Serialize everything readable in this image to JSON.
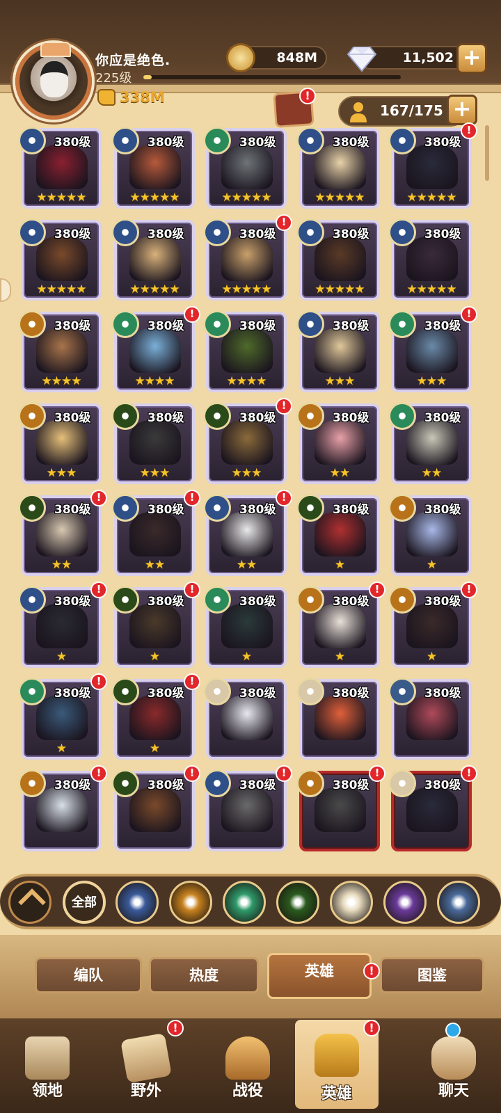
{
  "player": {
    "name": "你应是绝色.",
    "level": "225级",
    "power": "338M"
  },
  "resources": {
    "gold": "848M",
    "diamonds": "11,502"
  },
  "hero_count": "167/175",
  "heroes": [
    {
      "level": "380级",
      "stars": "★★★★★",
      "faction": "lightbearer",
      "notif": false,
      "frame": "purple",
      "art": "#8a2030"
    },
    {
      "level": "380级",
      "stars": "★★★★★",
      "faction": "lightbearer",
      "notif": false,
      "frame": "purple",
      "art": "#b65a3a"
    },
    {
      "level": "380级",
      "stars": "★★★★★",
      "faction": "wilder",
      "notif": false,
      "frame": "purple",
      "art": "#6e7478"
    },
    {
      "level": "380级",
      "stars": "★★★★★",
      "faction": "lightbearer",
      "notif": false,
      "frame": "purple",
      "art": "#e8d2a8"
    },
    {
      "level": "380级",
      "stars": "★★★★★",
      "faction": "lightbearer",
      "notif": true,
      "frame": "purple",
      "art": "#2a2a3a"
    },
    {
      "level": "380级",
      "stars": "★★★★★",
      "faction": "lightbearer",
      "notif": false,
      "frame": "purple",
      "art": "#7a4a2a"
    },
    {
      "level": "380级",
      "stars": "★★★★★",
      "faction": "lightbearer",
      "notif": false,
      "frame": "purple",
      "art": "#d9b27a"
    },
    {
      "level": "380级",
      "stars": "★★★★★",
      "faction": "lightbearer",
      "notif": true,
      "frame": "purple",
      "art": "#c9a06a"
    },
    {
      "level": "380级",
      "stars": "★★★★★",
      "faction": "lightbearer",
      "notif": false,
      "frame": "purple",
      "art": "#5a3a26"
    },
    {
      "level": "380级",
      "stars": "★★★★★",
      "faction": "lightbearer",
      "notif": false,
      "frame": "purple",
      "art": "#3a2a3a"
    },
    {
      "level": "380级",
      "stars": "★★★★",
      "faction": "maulers",
      "notif": false,
      "frame": "purple",
      "art": "#a8744a"
    },
    {
      "level": "380级",
      "stars": "★★★★",
      "faction": "wilder",
      "notif": true,
      "frame": "purple",
      "art": "#7ab0d8"
    },
    {
      "level": "380级",
      "stars": "★★★★",
      "faction": "wilder",
      "notif": false,
      "frame": "purple",
      "art": "#4e6a2a"
    },
    {
      "level": "380级",
      "stars": "★★★",
      "faction": "lightbearer",
      "notif": false,
      "frame": "purple",
      "art": "#e0c89a"
    },
    {
      "level": "380级",
      "stars": "★★★",
      "faction": "wilder",
      "notif": true,
      "frame": "purple",
      "art": "#6a8aa8"
    },
    {
      "level": "380级",
      "stars": "★★★",
      "faction": "maulers",
      "notif": false,
      "frame": "purple",
      "art": "#e6c07a"
    },
    {
      "level": "380级",
      "stars": "★★★",
      "faction": "graveborn",
      "notif": false,
      "frame": "purple",
      "art": "#3a3a3a"
    },
    {
      "level": "380级",
      "stars": "★★★",
      "faction": "graveborn",
      "notif": true,
      "frame": "purple",
      "art": "#8a6a3a"
    },
    {
      "level": "380级",
      "stars": "★★",
      "faction": "maulers",
      "notif": false,
      "frame": "purple",
      "art": "#e8a0a8"
    },
    {
      "level": "380级",
      "stars": "★★",
      "faction": "wilder",
      "notif": false,
      "frame": "purple",
      "art": "#c8c8b8"
    },
    {
      "level": "380级",
      "stars": "★★",
      "faction": "graveborn",
      "notif": true,
      "frame": "purple",
      "art": "#d8c8b0"
    },
    {
      "level": "380级",
      "stars": "★★",
      "faction": "lightbearer",
      "notif": true,
      "frame": "purple",
      "art": "#3a2a2a"
    },
    {
      "level": "380级",
      "stars": "★★",
      "faction": "lightbearer",
      "notif": true,
      "frame": "purple",
      "art": "#e8e8e8"
    },
    {
      "level": "380级",
      "stars": "★",
      "faction": "graveborn",
      "notif": false,
      "frame": "purple",
      "art": "#b03030"
    },
    {
      "level": "380级",
      "stars": "★",
      "faction": "maulers",
      "notif": false,
      "frame": "purple",
      "art": "#a8b8e8"
    },
    {
      "level": "380级",
      "stars": "★",
      "faction": "lightbearer",
      "notif": true,
      "frame": "purple",
      "art": "#2a2a32"
    },
    {
      "level": "380级",
      "stars": "★",
      "faction": "graveborn",
      "notif": true,
      "frame": "purple",
      "art": "#4a3a2a"
    },
    {
      "level": "380级",
      "stars": "★",
      "faction": "wilder",
      "notif": false,
      "frame": "purple",
      "art": "#2a3a3a"
    },
    {
      "level": "380级",
      "stars": "★",
      "faction": "maulers",
      "notif": true,
      "frame": "purple",
      "art": "#e8e0d8"
    },
    {
      "level": "380级",
      "stars": "★",
      "faction": "maulers",
      "notif": true,
      "frame": "purple",
      "art": "#3a2a2a"
    },
    {
      "level": "380级",
      "stars": "★",
      "faction": "wilder",
      "notif": true,
      "frame": "purple",
      "art": "#3a5a7a"
    },
    {
      "level": "380级",
      "stars": "★",
      "faction": "graveborn",
      "notif": true,
      "frame": "purple",
      "art": "#8a2a2a"
    },
    {
      "level": "380级",
      "stars": "",
      "faction": "celestial",
      "notif": false,
      "frame": "purple",
      "art": "#e8e8f0"
    },
    {
      "level": "380级",
      "stars": "",
      "faction": "celestial",
      "notif": false,
      "frame": "purple",
      "art": "#e0603a"
    },
    {
      "level": "380级",
      "stars": "",
      "faction": "dimensional",
      "notif": false,
      "frame": "purple",
      "art": "#b04a5a"
    },
    {
      "level": "380级",
      "stars": "",
      "faction": "maulers",
      "notif": true,
      "frame": "purple",
      "art": "#d8e0e8"
    },
    {
      "level": "380级",
      "stars": "",
      "faction": "graveborn",
      "notif": true,
      "frame": "purple",
      "art": "#7a4a2a"
    },
    {
      "level": "380级",
      "stars": "",
      "faction": "lightbearer",
      "notif": true,
      "frame": "purple",
      "art": "#6a6a6a"
    },
    {
      "level": "380级",
      "stars": "",
      "faction": "maulers",
      "notif": true,
      "frame": "red",
      "art": "#4a4a4a"
    },
    {
      "level": "380级",
      "stars": "",
      "faction": "celestial",
      "notif": true,
      "frame": "red",
      "art": "#2a2a3a"
    }
  ],
  "faction_colors": {
    "lightbearer": "#2f4f88",
    "maulers": "#b8731a",
    "wilder": "#2a8a5a",
    "graveborn": "#2a4a1a",
    "celestial": "#d8c8a8",
    "hypogean": "#5a2a8a",
    "dimensional": "#3a5a8a"
  },
  "filters": {
    "all_label": "全部",
    "items": [
      {
        "name": "lightbearer",
        "color": "#3a5a9a"
      },
      {
        "name": "maulers",
        "color": "#c8821e"
      },
      {
        "name": "wilder",
        "color": "#2e9a6a"
      },
      {
        "name": "graveborn",
        "color": "#2a5a1e"
      },
      {
        "name": "celestial",
        "color": "#e8dcc0"
      },
      {
        "name": "hypogean",
        "color": "#6a3a9a"
      },
      {
        "name": "dimensional",
        "color": "#4a6a9a"
      }
    ]
  },
  "lower_tabs": [
    "编队",
    "热度",
    "英雄",
    "图鉴"
  ],
  "bottom_nav": [
    "领地",
    "野外",
    "战役",
    "英雄",
    "聊天"
  ]
}
